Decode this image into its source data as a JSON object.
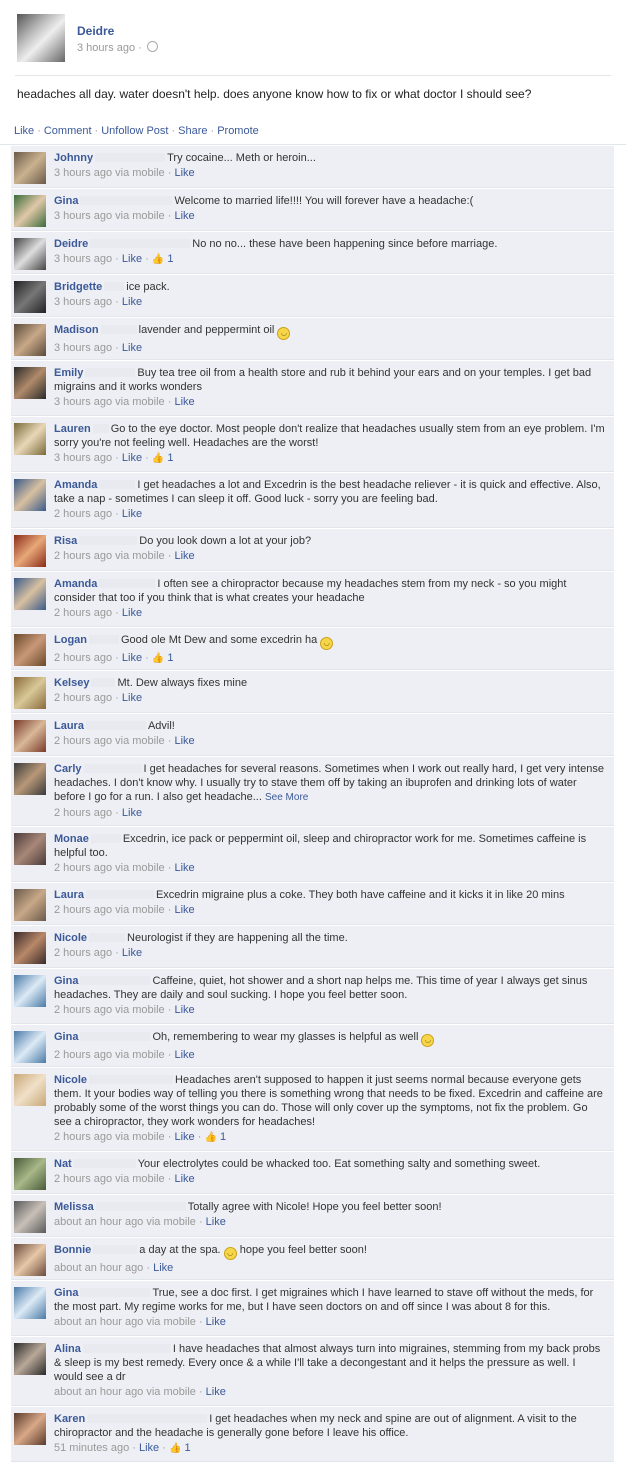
{
  "post": {
    "author": "Deidre",
    "time": "3 hours ago",
    "text": "headaches all day. water doesn't help. does anyone know how to fix or what doctor I should see?"
  },
  "actions": [
    "Like",
    "Comment",
    "Unfollow Post",
    "Share",
    "Promote"
  ],
  "see_more_label": "See More",
  "colors": {
    "link": "#3b5998",
    "comments_bg": "#edeff4",
    "meta": "#999999"
  },
  "comments": [
    {
      "name": "Johnny",
      "text": "Try cocaine... Meth or heroin...",
      "time": "3 hours ago via mobile",
      "likes": "",
      "redact": 70,
      "height": 43,
      "avatar": [
        "#6b5a4a",
        "#c9b28f"
      ]
    },
    {
      "name": "Gina",
      "text": "Welcome to married life!!!! You will forever have a headache:(",
      "time": "3 hours ago via mobile",
      "likes": "",
      "redact": 92,
      "height": 43,
      "avatar": [
        "#3a6b3a",
        "#e0c8a8"
      ]
    },
    {
      "name": "Deidre",
      "text": "No no no... these have been happening since before marriage.",
      "time": "3 hours ago",
      "likes": "1",
      "redact": 100,
      "height": 43,
      "avatar": [
        "#444",
        "#ddd"
      ]
    },
    {
      "name": "Bridgette",
      "text": "ice pack.",
      "time": "3 hours ago",
      "likes": "",
      "redact": 20,
      "height": 43,
      "avatar": [
        "#222",
        "#777"
      ]
    },
    {
      "name": "Madison",
      "text": "lavender and peppermint oil",
      "time": "3 hours ago",
      "likes": "",
      "redact": 36,
      "height": 43,
      "smiley": true,
      "avatar": [
        "#5a4a3a",
        "#c8a888"
      ]
    },
    {
      "name": "Emily",
      "text": "Buy tea tree oil from a health store and rub it behind your ears and on your temples. I get bad migrains and it works wonders",
      "time": "3 hours ago via mobile",
      "likes": "",
      "redact": 50,
      "height": 56,
      "avatar": [
        "#2a2a2a",
        "#b08a6a"
      ]
    },
    {
      "name": "Lauren",
      "text": "Go to the eye doctor. Most people don't realize that headaches usually stem from an eye problem. I'm sorry you're not feeling well. Headaches are the worst!",
      "time": "3 hours ago",
      "likes": "1",
      "redact": 16,
      "height": 56,
      "avatar": [
        "#7a6a3a",
        "#e8d8b8"
      ]
    },
    {
      "name": "Amanda",
      "text": "I get headaches a lot and Excedrin is the best headache reliever - it is quick and effective. Also, take a nap - sometimes I can sleep it off. Good luck - sorry you are feeling bad.",
      "time": "2 hours ago",
      "likes": "",
      "redact": 36,
      "height": 56,
      "avatar": [
        "#3a5a8a",
        "#d8c0a0"
      ]
    },
    {
      "name": "Risa",
      "text": "Do you look down a lot at your job?",
      "time": "2 hours ago via mobile",
      "likes": "",
      "redact": 58,
      "height": 43,
      "avatar": [
        "#8a2a1a",
        "#e8a878"
      ]
    },
    {
      "name": "Amanda",
      "text": "I often see a chiropractor because my headaches stem from my neck - so you might consider that too if you think that is what creates your headache",
      "time": "2 hours ago",
      "likes": "",
      "redact": 56,
      "height": 56,
      "avatar": [
        "#3a5a8a",
        "#d8c0a0"
      ]
    },
    {
      "name": "Logan",
      "text": "Good ole Mt Dew and some excedrin ha",
      "time": "2 hours ago",
      "likes": "1",
      "redact": 30,
      "height": 43,
      "smiley": true,
      "avatar": [
        "#6a4a2a",
        "#c89878"
      ]
    },
    {
      "name": "Kelsey",
      "text": "Mt. Dew always fixes mine",
      "time": "2 hours ago",
      "likes": "",
      "redact": 24,
      "height": 43,
      "avatar": [
        "#8a6a3a",
        "#d8c898"
      ]
    },
    {
      "name": "Laura",
      "text": "Advil!",
      "time": "2 hours ago via mobile",
      "likes": "",
      "redact": 60,
      "height": 43,
      "avatar": [
        "#7a3a2a",
        "#d8b898"
      ]
    },
    {
      "name": "Carly",
      "text": "I get headaches for several reasons. Sometimes when I work out really hard, I get very intense headaches. I don't know why. I usually try to stave them off by taking an ibuprofen and drinking lots of water before I go for a run. I also get headache...",
      "time": "2 hours ago",
      "likes": "",
      "redact": 58,
      "height": 70,
      "seemore": true,
      "avatar": [
        "#3a3a3a",
        "#b89878"
      ]
    },
    {
      "name": "Monae",
      "text": "Excedrin, ice pack or peppermint oil, sleep and chiropractor work for me. Sometimes caffeine is helpful too.",
      "time": "2 hours ago via mobile",
      "likes": "",
      "redact": 30,
      "height": 56,
      "avatar": [
        "#4a3a3a",
        "#a88878"
      ]
    },
    {
      "name": "Laura",
      "text": "Excedrin migraine plus a coke. They both have caffeine and it kicks it in like 20 mins",
      "time": "2 hours ago via mobile",
      "likes": "",
      "redact": 68,
      "height": 43,
      "avatar": [
        "#6a5a4a",
        "#c8a888"
      ]
    },
    {
      "name": "Nicole",
      "text": "Neurologist if they are happening all the time.",
      "time": "2 hours ago",
      "likes": "",
      "redact": 36,
      "height": 43,
      "avatar": [
        "#3a2a2a",
        "#b88868"
      ]
    },
    {
      "name": "Gina",
      "text": "Caffeine, quiet, hot shower and a short nap helps me. This time of year I always get sinus headaches. They are daily and soul sucking. I hope you feel better soon.",
      "time": "2 hours ago via mobile",
      "likes": "",
      "redact": 70,
      "height": 56,
      "avatar": [
        "#4a7aa8",
        "#dceaf5"
      ]
    },
    {
      "name": "Gina",
      "text": "Oh, remembering to wear my glasses is helpful as well",
      "time": "2 hours ago via mobile",
      "likes": "",
      "redact": 70,
      "height": 43,
      "smiley": true,
      "avatar": [
        "#4a7aa8",
        "#dceaf5"
      ]
    },
    {
      "name": "Nicole",
      "text": "Headaches aren't supposed to happen it just seems normal because everyone gets them. It your bodies way of telling you there is something wrong that needs to be fixed. Excedrin and caffeine are probably some of the worst things you can do. Those will only cover up the symptoms, not fix the problem. Go see a chiropractor, they work wonders for headaches!",
      "time": "2 hours ago via mobile",
      "likes": "1",
      "redact": 84,
      "height": 84,
      "avatar": [
        "#c8a878",
        "#f0e0c8"
      ]
    },
    {
      "name": "Nat",
      "text": "Your electrolytes could be whacked too. Eat something salty and something sweet.",
      "time": "2 hours ago via mobile",
      "likes": "",
      "redact": 62,
      "height": 43,
      "avatar": [
        "#4a5a3a",
        "#a8b888"
      ]
    },
    {
      "name": "Melissa",
      "text": "Totally agree with Nicole! Hope you feel better soon!",
      "time": "about an hour ago via mobile",
      "likes": "",
      "redact": 90,
      "height": 43,
      "avatar": [
        "#5a5a5a",
        "#c8c0b8"
      ]
    },
    {
      "name": "Bonnie",
      "text": "a day at the spa.",
      "time": "about an hour ago",
      "likes": "",
      "redact": 44,
      "height": 43,
      "smiley": true,
      "tail": "hope you feel better soon!",
      "avatar": [
        "#6a4a3a",
        "#e8c8a8"
      ]
    },
    {
      "name": "Gina",
      "text": "True, see a doc first. I get migraines which I have learned to stave off without the meds, for the most part. My regime works for me, but I have seen doctors on and off since I was about 8 for this.",
      "time": "about an hour ago via mobile",
      "likes": "",
      "redact": 70,
      "height": 56,
      "avatar": [
        "#4a7aa8",
        "#dceaf5"
      ]
    },
    {
      "name": "Alina",
      "text": "I have headaches that almost always turn into migraines, stemming from my back probs & sleep is my best remedy. Every once & a while I'll take a decongestant and it helps the pressure as well. I would see a dr",
      "time": "about an hour ago via mobile",
      "likes": "",
      "redact": 88,
      "height": 70,
      "avatar": [
        "#2a2a2a",
        "#b8a898"
      ]
    },
    {
      "name": "Karen",
      "text": "I get headaches when my neck and spine are out of alignment. A visit to the chiropractor and the headache is generally gone before I leave his office.",
      "time": "51 minutes ago",
      "likes": "1",
      "redact": 120,
      "height": 56,
      "avatar": [
        "#5a3a2a",
        "#d8a888"
      ]
    }
  ]
}
